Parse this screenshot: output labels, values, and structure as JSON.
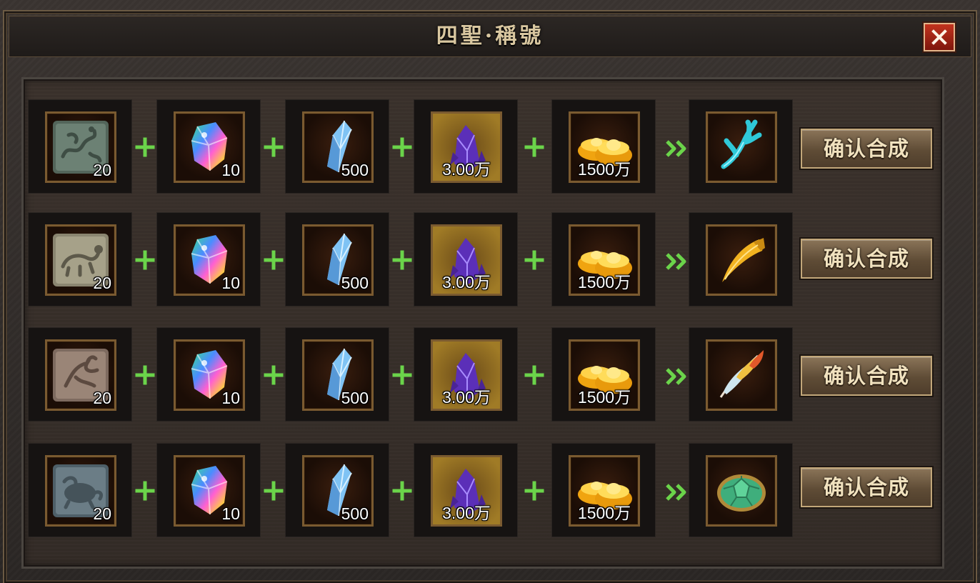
{
  "window": {
    "title": "四聖·稱號",
    "close_label": "X"
  },
  "recipes": [
    {
      "materials": [
        {
          "icon": "azure-dragon-tablet-icon",
          "qty": "20"
        },
        {
          "icon": "rainbow-crystal-icon",
          "qty": "10"
        },
        {
          "icon": "blue-crystal-shard-icon",
          "qty": "500"
        },
        {
          "icon": "purple-amethyst-icon",
          "qty": "3.00万"
        },
        {
          "icon": "gold-ingots-icon",
          "qty": "1500万"
        }
      ],
      "result_icon": "cyan-coral-icon",
      "button_label": "确认合成"
    },
    {
      "materials": [
        {
          "icon": "white-tiger-tablet-icon",
          "qty": "20"
        },
        {
          "icon": "rainbow-crystal-icon",
          "qty": "10"
        },
        {
          "icon": "blue-crystal-shard-icon",
          "qty": "500"
        },
        {
          "icon": "purple-amethyst-icon",
          "qty": "3.00万"
        },
        {
          "icon": "gold-ingots-icon",
          "qty": "1500万"
        }
      ],
      "result_icon": "golden-fang-icon",
      "button_label": "确认合成"
    },
    {
      "materials": [
        {
          "icon": "vermilion-bird-tablet-icon",
          "qty": "20"
        },
        {
          "icon": "rainbow-crystal-icon",
          "qty": "10"
        },
        {
          "icon": "blue-crystal-shard-icon",
          "qty": "500"
        },
        {
          "icon": "purple-amethyst-icon",
          "qty": "3.00万"
        },
        {
          "icon": "gold-ingots-icon",
          "qty": "1500万"
        }
      ],
      "result_icon": "phoenix-feather-icon",
      "button_label": "确认合成"
    },
    {
      "materials": [
        {
          "icon": "black-tortoise-tablet-icon",
          "qty": "20"
        },
        {
          "icon": "rainbow-crystal-icon",
          "qty": "10"
        },
        {
          "icon": "blue-crystal-shard-icon",
          "qty": "500"
        },
        {
          "icon": "purple-amethyst-icon",
          "qty": "3.00万"
        },
        {
          "icon": "gold-ingots-icon",
          "qty": "1500万"
        }
      ],
      "result_icon": "jade-turtle-shell-icon",
      "button_label": "确认合成"
    }
  ],
  "colors": {
    "plus_green": "#6bd44a",
    "slot_border_gold": "#7a5a30",
    "button_text": "#f1e2bf",
    "close_red": "#c2331e"
  }
}
